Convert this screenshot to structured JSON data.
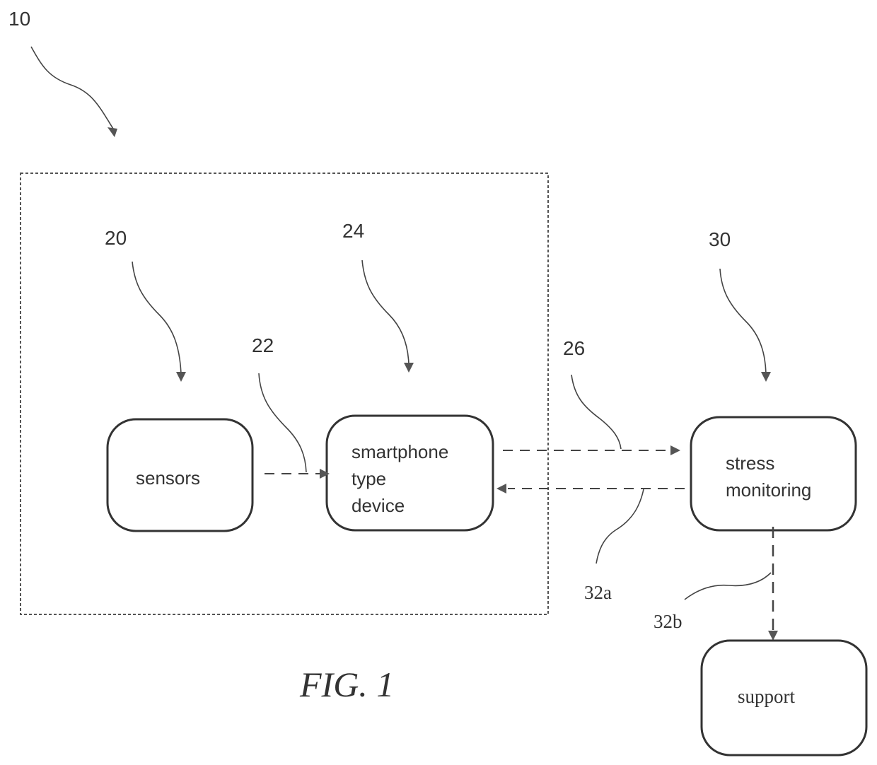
{
  "figure": {
    "caption": "FIG. 1",
    "system_label": "10",
    "nodes": [
      {
        "id": "sensors",
        "ref": "20",
        "lines": [
          "sensors"
        ]
      },
      {
        "id": "smartphone",
        "ref": "24",
        "lines": [
          "smartphone",
          "type",
          "device"
        ]
      },
      {
        "id": "stress-monitoring",
        "ref": "30",
        "lines": [
          "stress",
          "monitoring"
        ]
      },
      {
        "id": "support",
        "lines": [
          "support"
        ]
      }
    ],
    "connections": [
      {
        "ref": "22",
        "from": "sensors",
        "to": "smartphone"
      },
      {
        "ref": "26",
        "from": "smartphone",
        "to": "stress-monitoring"
      },
      {
        "ref": "32a",
        "from": "stress-monitoring",
        "to": "smartphone"
      },
      {
        "ref": "32b",
        "from": "stress-monitoring",
        "to": "support"
      }
    ]
  }
}
